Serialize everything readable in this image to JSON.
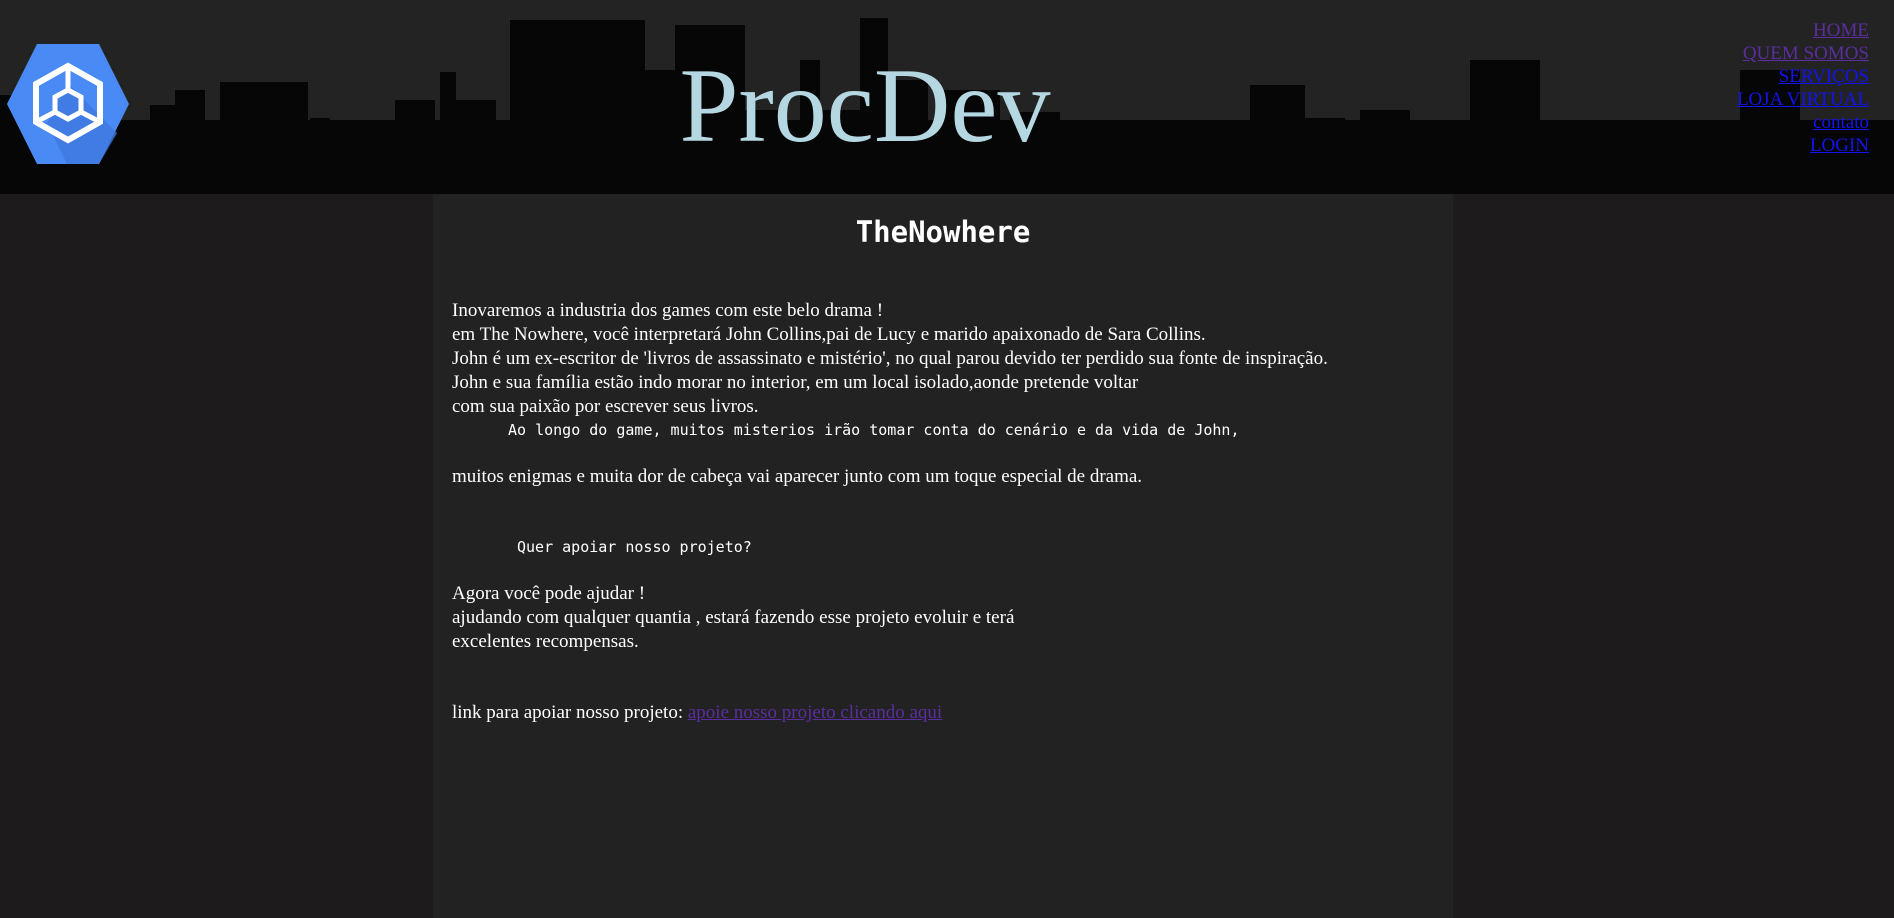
{
  "header": {
    "brand": "ProcDev",
    "nav": [
      {
        "label": "HOME",
        "state": "visited"
      },
      {
        "label": "QUEM SOMOS",
        "state": "visited"
      },
      {
        "label": "SERVIÇOS",
        "state": "unvisited"
      },
      {
        "label": "LOJA VIRTUAL",
        "state": "unvisited"
      },
      {
        "label": "contato",
        "state": "unvisited"
      },
      {
        "label": "LOGIN",
        "state": "unvisited"
      }
    ]
  },
  "article": {
    "title": "TheNowhere",
    "intro": [
      "Inovaremos a industria dos games com este belo drama !",
      "em The Nowhere, você interpretará John Collins,pai de Lucy e marido apaixonado de Sara Collins.",
      "John é um ex-escritor de 'livros de assassinato e mistério', no qual parou devido ter perdido sua fonte de inspiração.",
      "John e sua família estão indo morar no interior, em um local isolado,aonde pretende voltar",
      "com sua paixão por escrever seus livros."
    ],
    "mono_line": "Ao longo do game, muitos misterios irão tomar conta do cenário e da vida de John,",
    "enigmas_line": "muitos enigmas e muita dor de cabeça vai aparecer junto com um toque especial de drama.",
    "support_question": "Quer apoiar nosso projeto?",
    "support_text": [
      "Agora você pode ajudar !",
      "ajudando com qualquer quantia , estará fazendo esse projeto evoluir e terá",
      "excelentes recompensas."
    ],
    "link_prefix": "link para apoiar nosso projeto:",
    "link_label": "apoie nosso projeto clicando aqui"
  },
  "colors": {
    "brand": "#b4d7e2",
    "visited_link": "#5b2d9e",
    "unvisited_link": "#1313ee",
    "content_bg": "#222222",
    "page_bg": "#1d1b1b"
  }
}
